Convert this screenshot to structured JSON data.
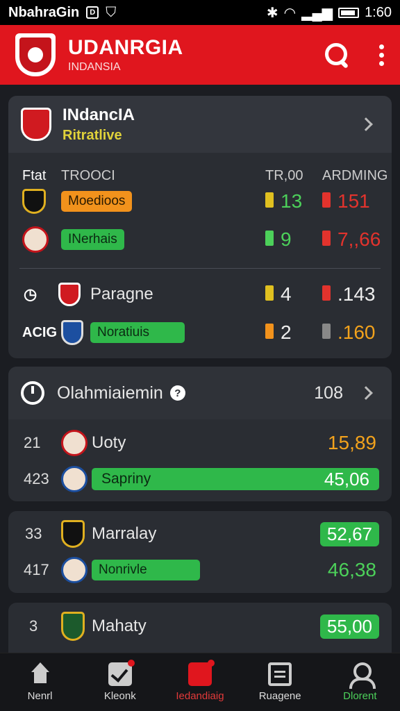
{
  "status": {
    "carrier": "NbahraGin",
    "time": "1:60"
  },
  "appbar": {
    "title": "UDANRGIA",
    "subtitle": "INDANSIA"
  },
  "card1": {
    "title": "INdancIA",
    "subtitle": "Ritratlive",
    "col_left_a": "Ftat",
    "col_left_b": "TROOCI",
    "col_right_a": "TR,00",
    "col_right_b": "ARDMING",
    "rows": [
      {
        "label": "Moedioos",
        "val1": "13",
        "val2": "151"
      },
      {
        "label": "INerhais",
        "val1": "9",
        "val2": "7,,66"
      },
      {
        "label": "Paragne",
        "val1": "4",
        "val2": ".143"
      },
      {
        "label": "Noratiuis",
        "val1": "2",
        "val2": ".160",
        "prefix": "ACIG"
      }
    ]
  },
  "card2": {
    "title": "Olahmiaiemin",
    "count": "108",
    "rows": [
      {
        "rank": "21",
        "label": "Uoty",
        "value": "15,89"
      },
      {
        "rank": "423",
        "label": "Sapriny",
        "value": "45,06"
      }
    ]
  },
  "card3": {
    "rows": [
      {
        "rank": "33",
        "label": "Marralay",
        "value": "52,67"
      },
      {
        "rank": "417",
        "label": "Nonrivle",
        "value": "46,38"
      }
    ]
  },
  "card4": {
    "rows": [
      {
        "rank": "3",
        "label": "Mahaty",
        "value": "55,00"
      }
    ]
  },
  "nav": [
    {
      "label": "Nenrl"
    },
    {
      "label": "Kleonk"
    },
    {
      "label": "Iedandiaig"
    },
    {
      "label": "Ruagene"
    },
    {
      "label": "Dlorent"
    }
  ]
}
